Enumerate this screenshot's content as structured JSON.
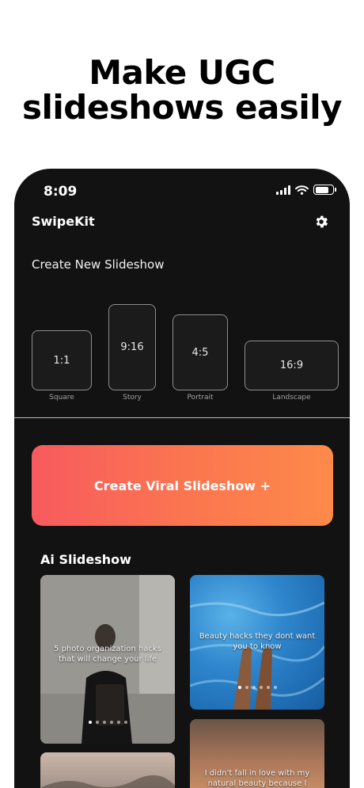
{
  "headline": {
    "line1": "Make UGC",
    "line2": "slideshows easily"
  },
  "status_bar": {
    "time": "8:09"
  },
  "app": {
    "name": "SwipeKit"
  },
  "create_new": {
    "label": "Create New Slideshow",
    "formats": [
      {
        "ratio": "1:1",
        "name": "Square"
      },
      {
        "ratio": "9:16",
        "name": "Story"
      },
      {
        "ratio": "4:5",
        "name": "Portrait"
      },
      {
        "ratio": "16:9",
        "name": "Landscape"
      }
    ]
  },
  "cta": {
    "label": "Create Viral Slideshow +"
  },
  "ai_section": {
    "title": "Ai Slideshow",
    "cards": [
      {
        "caption": "5 photo organization hacks that will change your life"
      },
      {
        "caption": "Beauty hacks they dont want you to know"
      },
      {
        "caption": "I didn't fall in love with my natural beauty because I"
      }
    ]
  },
  "colors": {
    "background": "#121212",
    "cta_start": "#f85a5e",
    "cta_end": "#fd8a4a"
  }
}
